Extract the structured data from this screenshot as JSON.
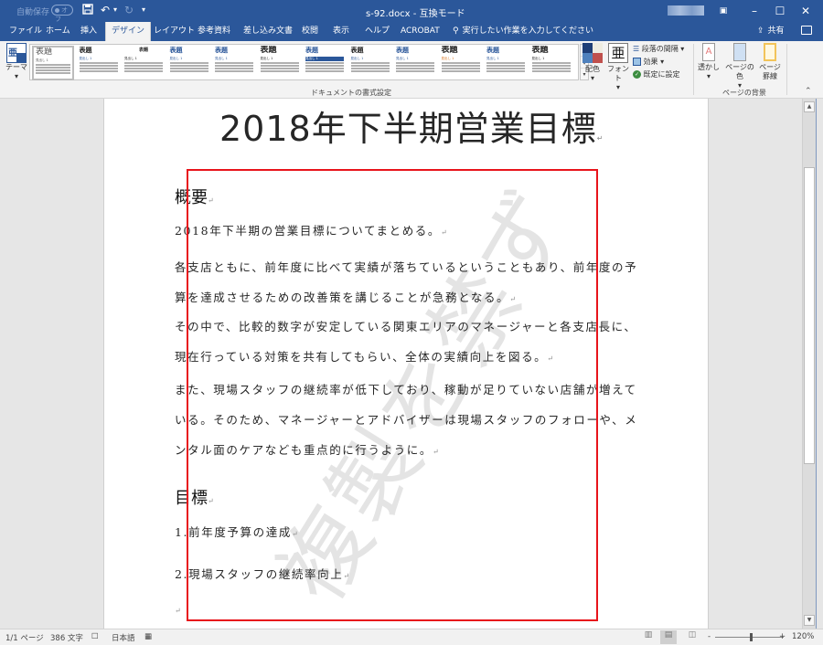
{
  "titlebar": {
    "autosave_label": "自動保存",
    "autosave_state": "オフ",
    "doc_title": "s-92.docx  -  互換モード",
    "save_icon": "save-icon",
    "undo_icon": "undo-icon",
    "redo_icon": "redo-icon",
    "customize_icon": "customize-qat-icon",
    "ribbon_display_icon": "ribbon-display-options-icon",
    "minimize": "–",
    "maximize": "☐",
    "close": "✕"
  },
  "tabs": [
    {
      "label": "ファイル"
    },
    {
      "label": "ホーム"
    },
    {
      "label": "挿入"
    },
    {
      "label": "デザイン",
      "active": true
    },
    {
      "label": "レイアウト"
    },
    {
      "label": "参考資料"
    },
    {
      "label": "差し込み文書"
    },
    {
      "label": "校閲"
    },
    {
      "label": "表示"
    },
    {
      "label": "ヘルプ"
    },
    {
      "label": "ACROBAT"
    }
  ],
  "tell_me": {
    "icon": "search-icon",
    "placeholder": "実行したい作業を入力してください"
  },
  "share": {
    "label": "共有",
    "icon": "share-icon"
  },
  "comments_icon": "comment-icon",
  "ribbon": {
    "theme_label": "テーマ",
    "gallery_items": [
      {
        "title": "表題",
        "heading": "見出し 1"
      },
      {
        "title": "表題",
        "heading": "見出し 1"
      },
      {
        "title": "表題",
        "heading": "見出し 1"
      },
      {
        "title": "表題",
        "heading": "見出し 1"
      },
      {
        "title": "表題",
        "heading": "見出し 1"
      },
      {
        "title": "表題",
        "heading": "見出し 1"
      },
      {
        "title": "表題",
        "heading": "見出し 1"
      },
      {
        "title": "表題",
        "heading": "見出し 1"
      },
      {
        "title": "表題",
        "heading": "見出し 1"
      },
      {
        "title": "表題",
        "heading": "見出し 1"
      },
      {
        "title": "表題",
        "heading": "見出し 1"
      },
      {
        "title": "表題",
        "heading": "見出し 1"
      }
    ],
    "doc_format_group_label": "ドキュメントの書式設定",
    "colors_label": "配色",
    "fonts_label": "フォント",
    "fonts_icon_glyph": "亜",
    "paragraph_spacing_label": "段落の間隔",
    "effects_label": "効果",
    "set_default_label": "既定に設定",
    "watermark_label": "透かし",
    "page_color_label": "ページの色",
    "page_borders_label": "ページ罫線",
    "page_background_group_label": "ページの背景"
  },
  "document": {
    "title": "2018年下半期営業目標",
    "sections": [
      {
        "heading": "概要",
        "paragraphs": [
          "2018年下半期の営業目標についてまとめる。",
          "各支店ともに、前年度に比べて実績が落ちているということもあり、前年度の予算を達成させるための改善策を講じることが急務となる。",
          "その中で、比較的数字が安定している関東エリアのマネージャーと各支店長に、現在行っている対策を共有してもらい、全体の実績向上を図る。",
          "また、現場スタッフの継続率が低下しており、稼動が足りていない店舗が増えている。そのため、マネージャーとアドバイザーは現場スタッフのフォローや、メンタル面のケアなども重点的に行うように。"
        ]
      },
      {
        "heading": "目標",
        "paragraphs": [
          "1.前年度予算の達成",
          "2.現場スタッフの継続率向上"
        ]
      }
    ],
    "paragraph_mark": "↵",
    "watermark_text": "複製を禁ず",
    "highlight_box_color": "#e8141b"
  },
  "statusbar": {
    "page": "1/1 ページ",
    "words": "386 文字",
    "proofing_icon": "proofing-icon",
    "language": "日本語",
    "macro_icon": "macro-icon",
    "zoom_minus": "-",
    "zoom_plus": "+",
    "zoom_level": "120%",
    "zoom_percent": 120
  },
  "colors": {
    "accent": "#2b579a",
    "ribbon_bg": "#f3f3f3",
    "canvas_bg": "#e6e6e6"
  }
}
